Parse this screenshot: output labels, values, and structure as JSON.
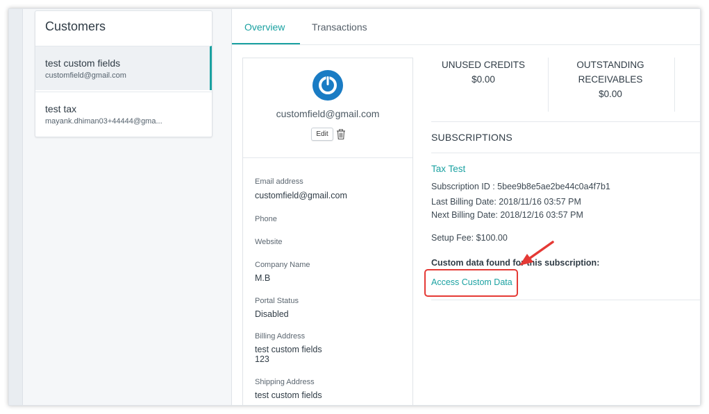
{
  "customers": {
    "title": "Customers",
    "items": [
      {
        "name": "test custom fields",
        "email": "customfield@gmail.com"
      },
      {
        "name": "test tax",
        "email": "mayank.dhiman03+44444@gma..."
      }
    ]
  },
  "tabs": [
    {
      "label": "Overview"
    },
    {
      "label": "Transactions"
    }
  ],
  "profile": {
    "email": "customfield@gmail.com",
    "edit_label": "Edit",
    "fields": {
      "email_label": "Email address",
      "email_value": "customfield@gmail.com",
      "phone_label": "Phone",
      "website_label": "Website",
      "company_label": "Company Name",
      "company_value": "M.B",
      "portal_label": "Portal Status",
      "portal_value": "Disabled",
      "billing_label": "Billing Address",
      "billing_line1": "test custom fields",
      "billing_line2": "123",
      "shipping_label": "Shipping Address",
      "shipping_line1": "test custom fields"
    }
  },
  "stats": {
    "unused_credits_label": "UNUSED CREDITS",
    "unused_credits_value": "$0.00",
    "outstanding_label_line1": "OUTSTANDING",
    "outstanding_label_line2": "RECEIVABLES",
    "outstanding_value": "$0.00"
  },
  "subscriptions": {
    "title": "SUBSCRIPTIONS",
    "name": "Tax Test",
    "subscription_id": "Subscription ID : 5bee9b8e5ae2be44c0a4f7b1",
    "last_billing": "Last Billing Date: 2018/11/16 03:57 PM",
    "next_billing": "Next Billing Date: 2018/12/16 03:57 PM",
    "setup_fee": "Setup Fee: $100.00",
    "custom_data_title": "Custom data found for this subscription:",
    "access_link": "Access Custom Data"
  },
  "colors": {
    "accent": "#1aa1a1",
    "avatar": "#1a7cc4",
    "highlight": "#e53935"
  }
}
